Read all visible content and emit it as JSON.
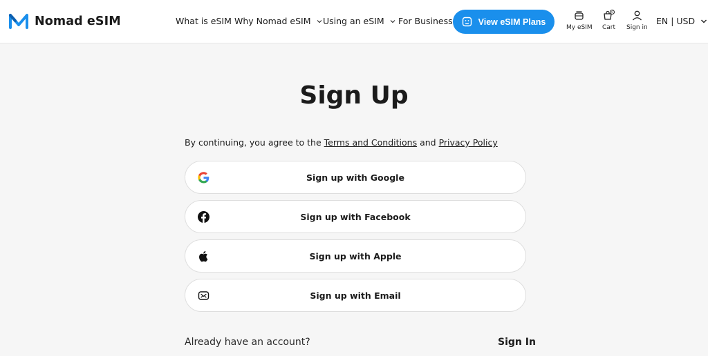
{
  "header": {
    "brand": "Nomad eSIM",
    "nav": {
      "what_is": "What is eSIM",
      "why": "Why Nomad eSIM",
      "using": "Using an eSIM",
      "business": "For Business"
    },
    "cta": "View eSIM Plans",
    "tools": {
      "my_esim": "My eSIM",
      "cart": "Cart",
      "cart_count": "0",
      "sign_in": "Sign in"
    },
    "locale": "EN | USD"
  },
  "main": {
    "title": "Sign Up",
    "terms_prefix": "By continuing, you agree to the ",
    "terms_link": "Terms and Conditions",
    "terms_and": " and ",
    "privacy_link": "Privacy Policy",
    "buttons": {
      "google": "Sign up with Google",
      "facebook": "Sign up with Facebook",
      "apple": "Sign up with Apple",
      "email": "Sign up with Email"
    },
    "already": "Already have an account?",
    "sign_in": "Sign In"
  },
  "colors": {
    "accent": "#1a8fec",
    "background": "#f6f6f6",
    "text": "#1b1b1b"
  },
  "icons": {
    "logo": "nomad-logo-icon",
    "chevron": "chevron-down-icon",
    "plans": "esim-card-icon",
    "my_esim": "esim-stack-icon",
    "cart": "cart-icon",
    "user": "user-icon",
    "google": "google-icon",
    "facebook": "facebook-icon",
    "apple": "apple-icon",
    "email": "email-icon"
  }
}
